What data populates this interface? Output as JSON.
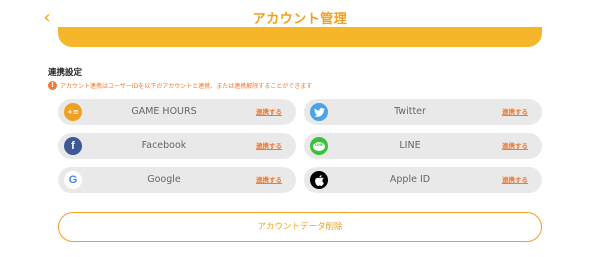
{
  "header": {
    "back_icon": "chevron-left-icon",
    "title": "アカウント管理"
  },
  "colors": {
    "accent": "#f0a020",
    "warning": "#ee7a33",
    "pill_bg": "#e9e9e9"
  },
  "section": {
    "title": "連携設定",
    "notice": "アカウント連携はユーザーIDを以下のアカウントと連携、または連携解除することができます"
  },
  "accounts": [
    {
      "name": "GAME HOURS",
      "action": "連携する",
      "icon": "game-hours-icon",
      "icon_text": "+≡"
    },
    {
      "name": "Twitter",
      "action": "連携する",
      "icon": "twitter-icon"
    },
    {
      "name": "Facebook",
      "action": "連携する",
      "icon": "facebook-icon",
      "icon_text": "f"
    },
    {
      "name": "LINE",
      "action": "連携する",
      "icon": "line-icon",
      "icon_text": "LINE"
    },
    {
      "name": "Google",
      "action": "連携する",
      "icon": "google-icon",
      "icon_text": "G"
    },
    {
      "name": "Apple ID",
      "action": "連携する",
      "icon": "apple-icon"
    }
  ],
  "delete_button": "アカウントデータ削除"
}
